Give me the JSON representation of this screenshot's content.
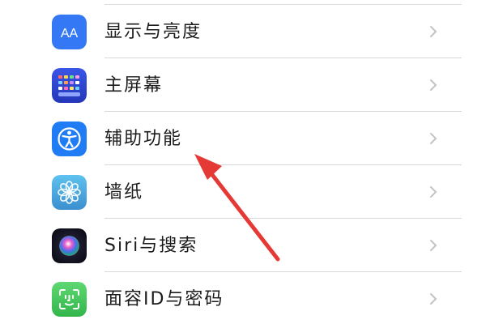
{
  "settings": {
    "items": [
      {
        "label": "显示与亮度",
        "icon": "display-brightness-icon",
        "icon_text": "AA",
        "icon_color": "#3478f6"
      },
      {
        "label": "主屏幕",
        "icon": "home-screen-icon",
        "icon_color": "#2f4ad8"
      },
      {
        "label": "辅助功能",
        "icon": "accessibility-icon",
        "icon_color": "#1f7cf4"
      },
      {
        "label": "墙纸",
        "icon": "wallpaper-icon",
        "icon_color": "#4aa8d8"
      },
      {
        "label": "Siri与搜索",
        "icon": "siri-icon",
        "icon_color": "#1a1a2e"
      },
      {
        "label": "面容ID与密码",
        "icon": "face-id-icon",
        "icon_color": "#3ec75a"
      }
    ]
  },
  "annotation": {
    "type": "red-arrow",
    "color": "#e53935",
    "target": "辅助功能"
  },
  "colors": {
    "background": "#ffffff",
    "label_text": "#1c1c1e",
    "separator": "#d8d8dc",
    "chevron": "#c4c4c8"
  }
}
